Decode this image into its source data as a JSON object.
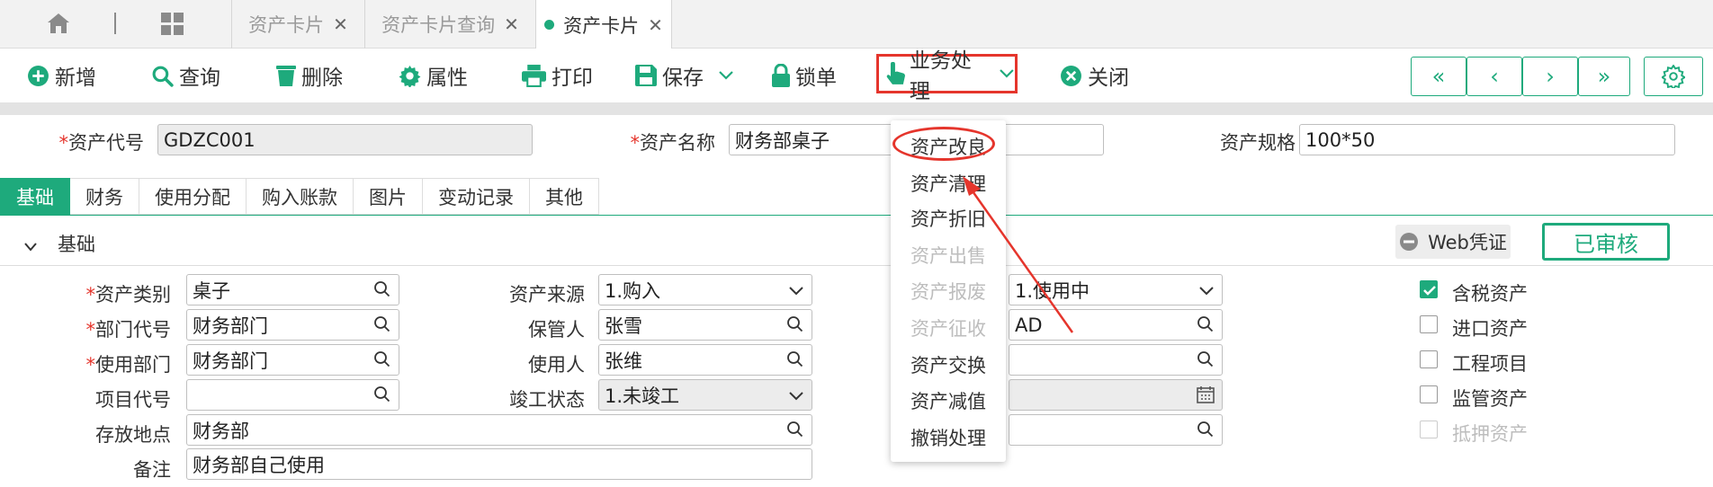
{
  "tabs": [
    {
      "label": "资产卡片",
      "closable": true,
      "active": false
    },
    {
      "label": "资产卡片查询",
      "closable": true,
      "active": false
    },
    {
      "label": "资产卡片",
      "closable": true,
      "active": true
    }
  ],
  "close_glyph": "✕",
  "toolbar": {
    "add": "新增",
    "query": "查询",
    "delete": "删除",
    "props": "属性",
    "print": "打印",
    "save": "保存",
    "lock": "锁单",
    "business": "业务处理",
    "close": "关闭"
  },
  "nav": {
    "first": "«",
    "prev": "‹",
    "next": "›",
    "last": "»"
  },
  "header": {
    "asset_code_label": "资产代号",
    "asset_code": "GDZC001",
    "asset_name_label": "资产名称",
    "asset_name": "财务部桌子",
    "asset_spec_label": "资产规格",
    "asset_spec": "100*50"
  },
  "section_tabs": [
    "基础",
    "财务",
    "使用分配",
    "购入账款",
    "图片",
    "变动记录",
    "其他"
  ],
  "section": {
    "title": "基础",
    "web_voucher": "Web凭证",
    "status": "已审核"
  },
  "form": {
    "category_label": "资产类别",
    "category": "桌子",
    "dept_code_label": "部门代号",
    "dept_code": "财务部门",
    "use_dept_label": "使用部门",
    "use_dept": "财务部门",
    "project_label": "项目代号",
    "project": "",
    "location_label": "存放地点",
    "location": "财务部",
    "remark_label": "备注",
    "remark": "财务部自己使用",
    "source_label": "资产来源",
    "source": "1.购入",
    "keeper_label": "保管人",
    "keeper": "张雪",
    "user_label": "使用人",
    "user": "张维",
    "completion_label": "竣工状态",
    "completion": "1.未竣工",
    "status_value": "1.使用中",
    "ad_value": "AD"
  },
  "checkboxes": [
    {
      "label": "含税资产",
      "checked": true,
      "disabled": false
    },
    {
      "label": "进口资产",
      "checked": false,
      "disabled": false
    },
    {
      "label": "工程项目",
      "checked": false,
      "disabled": false
    },
    {
      "label": "监管资产",
      "checked": false,
      "disabled": false
    },
    {
      "label": "抵押资产",
      "checked": false,
      "disabled": true
    }
  ],
  "menu": [
    {
      "label": "资产改良",
      "disabled": false,
      "highlight": true
    },
    {
      "label": "资产清理",
      "disabled": false
    },
    {
      "label": "资产折旧",
      "disabled": false
    },
    {
      "label": "资产出售",
      "disabled": true
    },
    {
      "label": "资产报废",
      "disabled": true
    },
    {
      "label": "资产征收",
      "disabled": true
    },
    {
      "label": "资产交换",
      "disabled": false
    },
    {
      "label": "资产减值",
      "disabled": false
    },
    {
      "label": "撤销处理",
      "disabled": false
    }
  ],
  "colors": {
    "accent": "#1eaa7c",
    "highlight": "#e5352c",
    "disabled": "#bdbdbd"
  }
}
